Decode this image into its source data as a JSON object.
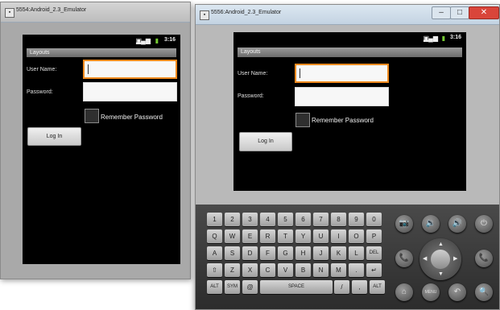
{
  "emulators": [
    {
      "window_title": "5554:Android_2.3_Emulator",
      "status_time": "3:16",
      "app_title": "Layouts",
      "username_label": "User Name:",
      "password_label": "Password:",
      "remember_label": "Remember Password",
      "login_label": "Log In"
    },
    {
      "window_title": "5556:Android_2.3_Emulator",
      "status_time": "3:16",
      "app_title": "Layouts",
      "username_label": "User Name:",
      "password_label": "Password:",
      "remember_label": "Remember Password",
      "login_label": "Log In"
    }
  ],
  "window_controls": {
    "minimize": "–",
    "maximize": "□",
    "close": "✕"
  },
  "keyboard": {
    "rows": [
      [
        "1",
        "2",
        "3",
        "4",
        "5",
        "6",
        "7",
        "8",
        "9",
        "0"
      ],
      [
        "Q",
        "W",
        "E",
        "R",
        "T",
        "Y",
        "U",
        "I",
        "O",
        "P"
      ],
      [
        "A",
        "S",
        "D",
        "F",
        "G",
        "H",
        "J",
        "K",
        "L",
        "DEL"
      ],
      [
        "⇧",
        "Z",
        "X",
        "C",
        "V",
        "B",
        "N",
        "M",
        ".",
        "↵"
      ],
      [
        "ALT",
        "SYM",
        "@",
        "SPACE",
        "/",
        ",",
        "ALT"
      ]
    ]
  },
  "hardware_buttons": {
    "camera": "📷",
    "vol_down": "🔉",
    "vol_up": "🔊",
    "power": "⏻",
    "call": "📞",
    "end": "📞",
    "home": "⌂",
    "menu": "MENU",
    "back": "↶",
    "search": "🔍"
  },
  "colors": {
    "focus_border": "#f08a1e",
    "screen_bg": "#000000"
  }
}
